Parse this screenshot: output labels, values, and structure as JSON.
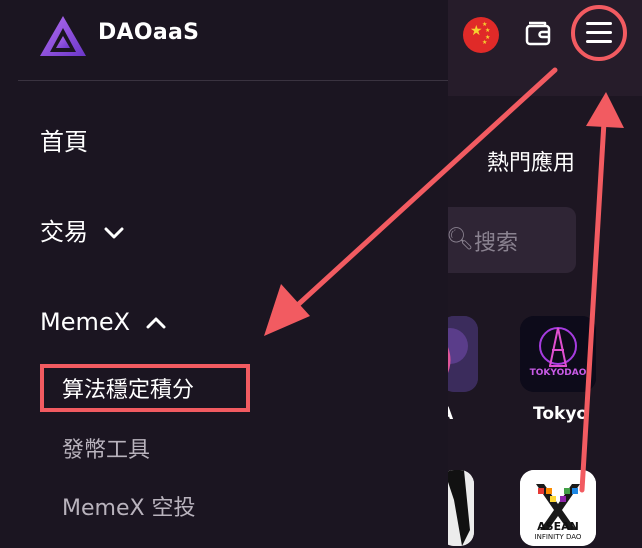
{
  "header": {
    "brand": "DAOaaS",
    "icons": [
      "china-flag-icon",
      "wallet-icon",
      "hamburger-menu-icon"
    ]
  },
  "nav": {
    "home": "首頁",
    "trade": "交易",
    "memex": "MemeX",
    "memex_sub": [
      "算法穩定積分",
      "發幣工具",
      "MemeX 空投"
    ]
  },
  "page": {
    "hot_apps": "熱門應用",
    "search_placeholder": "搜索",
    "apps": [
      {
        "label": "A"
      },
      {
        "label": "Tokyo"
      },
      {
        "label": ""
      },
      {
        "label": "ASEAN INFINITY DAO"
      }
    ],
    "app2_logo_text": "TOKYODAO",
    "app4_logo_text_1": "ASEAN",
    "app4_logo_text_2": "INFINITY DAO"
  },
  "colors": {
    "background": "#1b1521",
    "annotation_red": "#f25b61"
  }
}
